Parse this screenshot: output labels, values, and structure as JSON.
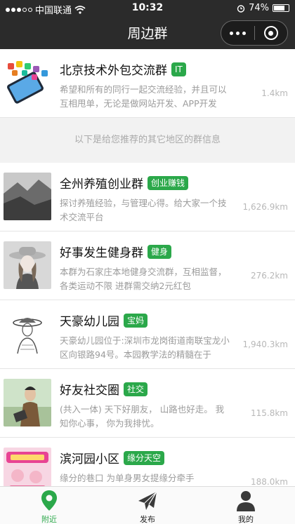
{
  "status": {
    "carrier": "中国联通",
    "time": "10:32",
    "battery": "74%",
    "battery_level": 0.74
  },
  "nav": {
    "title": "周边群"
  },
  "colors": {
    "accent": "#2ba84a",
    "bar": "#2b2b2b"
  },
  "top_item": {
    "name": "北京技术外包交流群",
    "tag": "IT",
    "desc": "希望和所有的同行一起交流经验，并且可以互相甩单，无论是做网站开发、APP开发",
    "distance": "1.4km",
    "thumb_icon": "phone-apps-icon"
  },
  "notice": "以下是给您推荐的其它地区的群信息",
  "groups": [
    {
      "name": "全州养殖创业群",
      "tag": "创业赚钱",
      "desc": "探讨养殖经验，与管理心得。给大家一个技术交流平台",
      "distance": "1,626.9km"
    },
    {
      "name": "好事发生健身群",
      "tag": "健身",
      "desc": "本群为石家庄本地健身交流群，互相监督，各类运动不限 进群需交纳2元红包",
      "distance": "276.2km"
    },
    {
      "name": "天豪幼儿园",
      "tag": "宝妈",
      "desc": "天豪幼儿园位于:深圳市龙岗街道南联宝龙小区向银路94号。本园教学法的精髓在于",
      "distance": "1,940.3km"
    },
    {
      "name": "好友社交圈",
      "tag": "社交",
      "desc": "(共入一体) 天下好朋友， 山路也好走。 我知你心事， 你为我排忧。",
      "distance": "115.8km"
    },
    {
      "name": "滨河园小区",
      "tag": "缘分天空",
      "desc": "缘分的巷口 为单身男女提缘分牵手",
      "distance": "188.0km"
    }
  ],
  "tabs": [
    {
      "label": "附近",
      "icon": "location-pin-icon",
      "active": true
    },
    {
      "label": "发布",
      "icon": "paper-plane-icon",
      "active": false
    },
    {
      "label": "我的",
      "icon": "user-icon",
      "active": false
    }
  ]
}
